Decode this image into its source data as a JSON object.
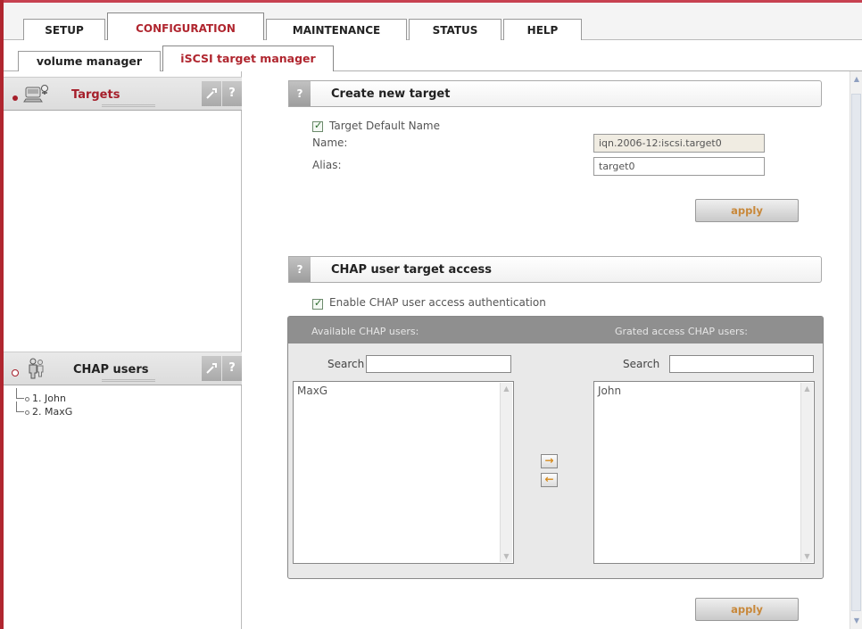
{
  "main_tabs": [
    {
      "label": "SETUP",
      "active": false
    },
    {
      "label": "CONFIGURATION",
      "active": true
    },
    {
      "label": "MAINTENANCE",
      "active": false
    },
    {
      "label": "STATUS",
      "active": false
    },
    {
      "label": "HELP",
      "active": false
    }
  ],
  "sub_tabs": [
    {
      "label": "volume manager",
      "active": false
    },
    {
      "label": "iSCSI target manager",
      "active": true
    }
  ],
  "left_panel": {
    "targets": {
      "title": "Targets",
      "wrench": "✓",
      "help": "?"
    },
    "chap_users": {
      "title": "CHAP users",
      "wrench": "✓",
      "help": "?",
      "items": [
        "1. John",
        "2. MaxG"
      ]
    }
  },
  "create_target": {
    "help": "?",
    "title": "Create new target",
    "default_name_label": "Target Default Name",
    "default_name_checked": true,
    "name_label": "Name:",
    "name_value": "iqn.2006-12:iscsi.target0",
    "alias_label": "Alias:",
    "alias_value": "target0",
    "apply_label": "apply"
  },
  "chap_access": {
    "help": "?",
    "title": "CHAP user target access",
    "enable_label": "Enable CHAP user access authentication",
    "enable_checked": true,
    "available_header": "Available CHAP users:",
    "granted_header": "Grated access CHAP users:",
    "search_label": "Search",
    "available_users": [
      "MaxG"
    ],
    "granted_users": [
      "John"
    ],
    "add_arrow": "→",
    "remove_arrow": "←",
    "apply_label": "apply"
  },
  "colors": {
    "accent": "#b0262f",
    "apply_text": "#c8883a"
  }
}
